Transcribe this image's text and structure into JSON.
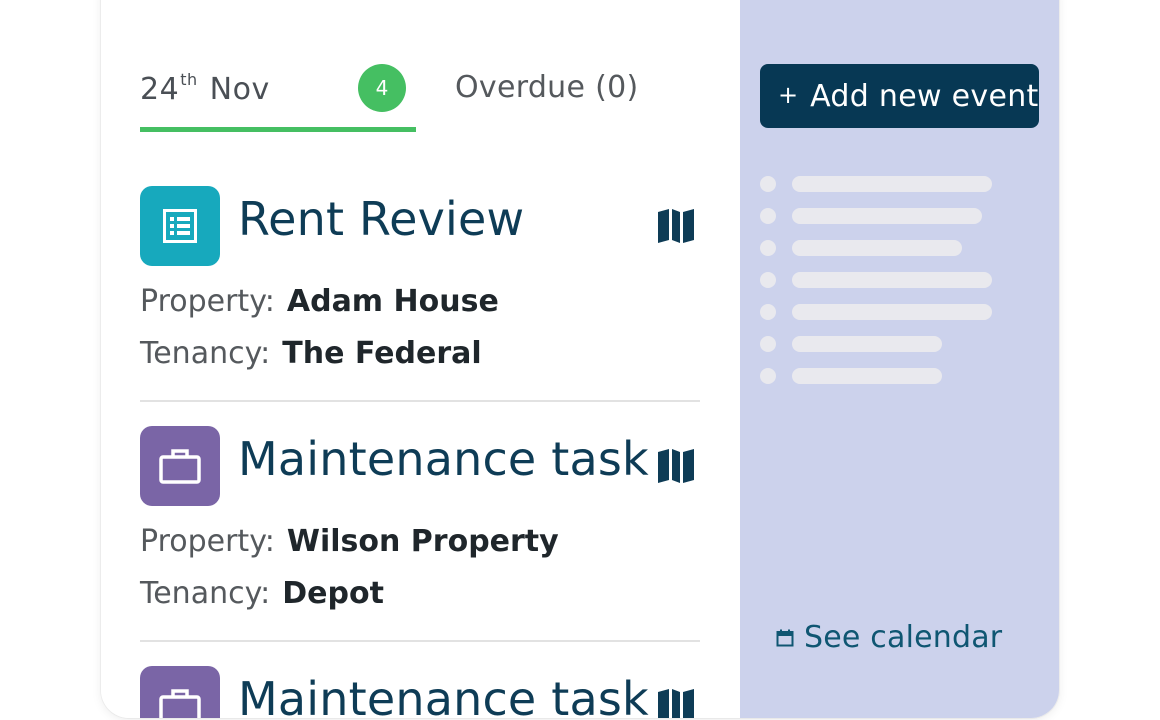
{
  "tabs": {
    "date_day": "24",
    "date_suffix": "th",
    "date_month": "Nov",
    "date_count": "4",
    "overdue_label": "Overdue (0)"
  },
  "events": [
    {
      "title": "Rent Review",
      "type_icon": "document-list-icon",
      "tile_color": "#17a9bd",
      "property_label": "Property:",
      "property": "Adam House",
      "tenancy_label": "Tenancy:",
      "tenancy": "The Federal"
    },
    {
      "title": "Maintenance task",
      "type_icon": "briefcase-icon",
      "tile_color": "#7a65a6",
      "property_label": "Property:",
      "property": "Wilson Property",
      "tenancy_label": "Tenancy:",
      "tenancy": "Depot"
    },
    {
      "title": "Maintenance task",
      "type_icon": "briefcase-icon",
      "tile_color": "#7a65a6"
    }
  ],
  "sidebar": {
    "add_button_plus": "+",
    "add_button_label": "Add new event",
    "see_calendar_label": "See calendar",
    "placeholder_rows": 7
  },
  "colors": {
    "accent_green": "#45bf62",
    "navy": "#073854",
    "panel_bg": "#ccd2ec",
    "rent_review_tile": "#17a9bd",
    "maintenance_tile": "#7a65a6"
  }
}
